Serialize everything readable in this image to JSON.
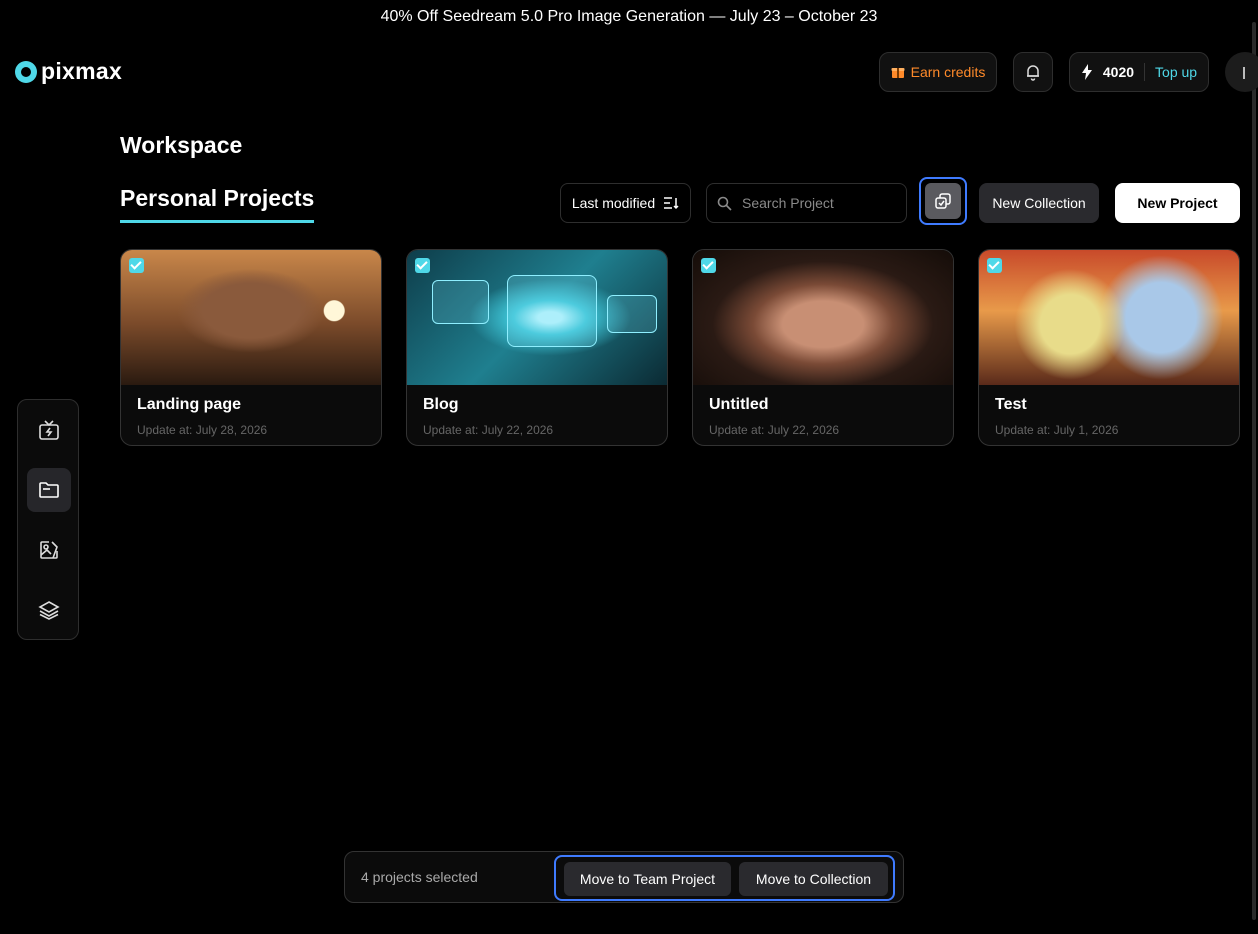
{
  "banner": {
    "text": "40% Off Seedream 5.0 Pro Image Generation — July 23 – October 23"
  },
  "brand": {
    "name": "pixmax",
    "accent": "#4fd8e8",
    "selection_outline": "#3f7bff"
  },
  "header": {
    "earn_credits": "Earn credits",
    "credits": "4020",
    "top_up": "Top up"
  },
  "workspace": {
    "title": "Workspace",
    "tab": "Personal Projects",
    "sort_label": "Last modified",
    "search_placeholder": "Search Project",
    "new_collection": "New Collection",
    "new_project": "New Project"
  },
  "projects": [
    {
      "title": "Landing page",
      "date": "Update at: July 28, 2026",
      "selected": true
    },
    {
      "title": "Blog",
      "date": "Update at: July 22, 2026",
      "selected": true
    },
    {
      "title": "Untitled",
      "date": "Update at: July 22, 2026",
      "selected": true
    },
    {
      "title": "Test",
      "date": "Update at: July 1, 2026",
      "selected": true
    }
  ],
  "sidebar": {
    "icons": [
      "tv-icon",
      "folder-icon",
      "image-edit-icon",
      "layers-icon"
    ],
    "active": "folder-icon"
  },
  "selection_bar": {
    "count_text": "4 projects selected",
    "move_team": "Move to Team Project",
    "move_collection": "Move to Collection"
  }
}
